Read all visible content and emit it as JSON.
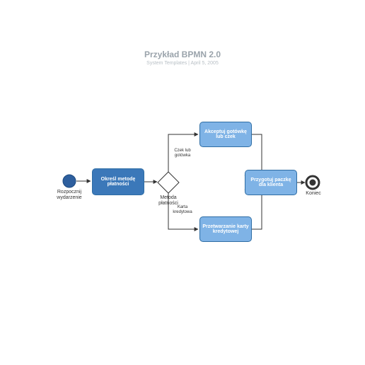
{
  "header": {
    "title": "Przykład BPMN 2.0",
    "subtitle": "System Templates  |  April 5, 2005"
  },
  "events": {
    "start_label": "Rozpocznij\nwydarzenie",
    "end_label": "Koniec"
  },
  "gateway": {
    "label": "Metoda\npłatności",
    "branch_top": "Czek lub\ngotówka",
    "branch_bottom": "Karta\nkredytowa"
  },
  "tasks": {
    "define": "Określ metodę\npłatności",
    "accept": "Akceptuj gotówkę\nlub czek",
    "process": "Przetwarzanie karty\nkredytowej",
    "prepare": "Przygotuj paczkę\ndla klienta"
  }
}
